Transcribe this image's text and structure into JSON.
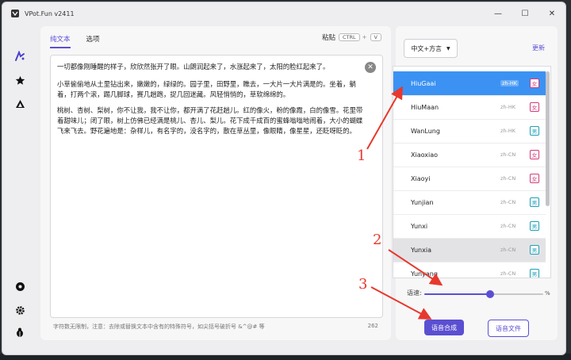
{
  "window": {
    "title": "VPot.Fun v2411",
    "controls": {
      "minimize": "—",
      "maximize": "☐",
      "close": "✕"
    }
  },
  "rail": {
    "icons": [
      "voice-icon",
      "star-icon",
      "triangle-icon",
      "aperture-icon",
      "gear-icon",
      "bug-icon"
    ]
  },
  "editor": {
    "tabs": [
      {
        "label": "纯文本"
      },
      {
        "label": "选项"
      }
    ],
    "paste": {
      "label": "粘贴",
      "key1": "CTRL",
      "plus": "+",
      "key2": "V"
    },
    "paragraphs": [
      "一切都像刚睡醒的样子，欣欣然张开了眼。山朗润起来了，水涨起来了，太阳的脸红起来了。",
      "小草偷偷地从土里钻出来，嫩嫩的，绿绿的。园子里，田野里，瞧去，一大片一大片满是的。坐着，躺着，打两个滚，踢几脚球，赛几趟跑，捉几回迷藏。风轻悄悄的，草软绵绵的。",
      "桃树、杏树、梨树，你不让我，我不让你，都开满了花赶趟儿。红的像火，粉的像霞，白的像雪。花里带着甜味儿；闭了眼，树上仿佛已经满是桃儿、杏儿、梨儿。花下成千成百的蜜蜂嗡嗡地闹着，大小的蝴蝶飞来飞去。野花遍地是：杂样儿，有名字的，没名字的，散在草丛里，像眼睛，像星星，还眨呀眨的。"
    ],
    "clear_icon": "✕",
    "footer_note": "字符数无限制，注意：去除或替换文本中含有的特殊符号，如尖括号破折号 &^@# 等",
    "char_count": "262"
  },
  "voice": {
    "language": "中文+方言",
    "refresh": "更新",
    "items": [
      {
        "name": "HiuGaai",
        "locale": "zh-HK",
        "gender": "女",
        "g": "f",
        "state": "selected"
      },
      {
        "name": "HiuMaan",
        "locale": "zh-HK",
        "gender": "女",
        "g": "f",
        "state": ""
      },
      {
        "name": "WanLung",
        "locale": "zh-HK",
        "gender": "男",
        "g": "m",
        "state": ""
      },
      {
        "name": "Xiaoxiao",
        "locale": "zh-CN",
        "gender": "女",
        "g": "f",
        "state": ""
      },
      {
        "name": "Xiaoyi",
        "locale": "zh-CN",
        "gender": "女",
        "g": "f",
        "state": ""
      },
      {
        "name": "Yunjian",
        "locale": "zh-CN",
        "gender": "男",
        "g": "m",
        "state": ""
      },
      {
        "name": "Yunxi",
        "locale": "zh-CN",
        "gender": "男",
        "g": "m",
        "state": ""
      },
      {
        "name": "Yunxia",
        "locale": "zh-CN",
        "gender": "男",
        "g": "m",
        "state": "hover"
      },
      {
        "name": "Yunyang",
        "locale": "zh-CN",
        "gender": "男",
        "g": "m",
        "state": ""
      }
    ],
    "speed": {
      "label": "语速:",
      "unit": "%",
      "level": 0.55
    },
    "synth_button": "语音合成",
    "file_button": "语音文件"
  },
  "annotations": [
    "1",
    "2",
    "3"
  ],
  "colors": {
    "accent": "#5b4fd1",
    "selected": "#3b92f3",
    "annotation": "#e8382d"
  }
}
